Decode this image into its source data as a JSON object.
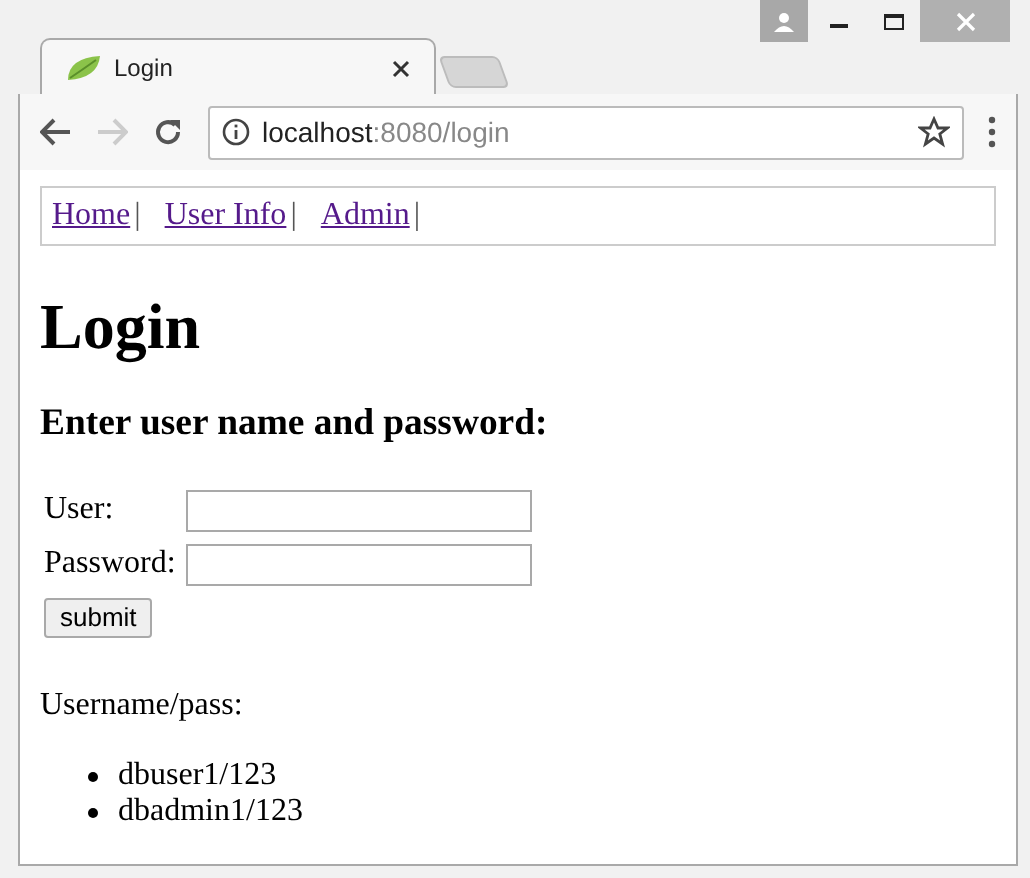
{
  "tab": {
    "title": "Login",
    "selected": true
  },
  "address_bar": {
    "host": "localhost",
    "path": ":8080/login"
  },
  "nav": {
    "links": [
      {
        "label": "Home",
        "separator": "|"
      },
      {
        "label": "User Info",
        "separator": "|"
      },
      {
        "label": "Admin",
        "separator": "|"
      }
    ]
  },
  "heading": "Login",
  "subheading": "Enter user name and password:",
  "form": {
    "fields": [
      {
        "label": "User:"
      },
      {
        "label": "Password:"
      }
    ],
    "submit": "submit"
  },
  "hint": "Username/pass:",
  "accounts": [
    "dbuser1/123",
    "dbadmin1/123"
  ]
}
